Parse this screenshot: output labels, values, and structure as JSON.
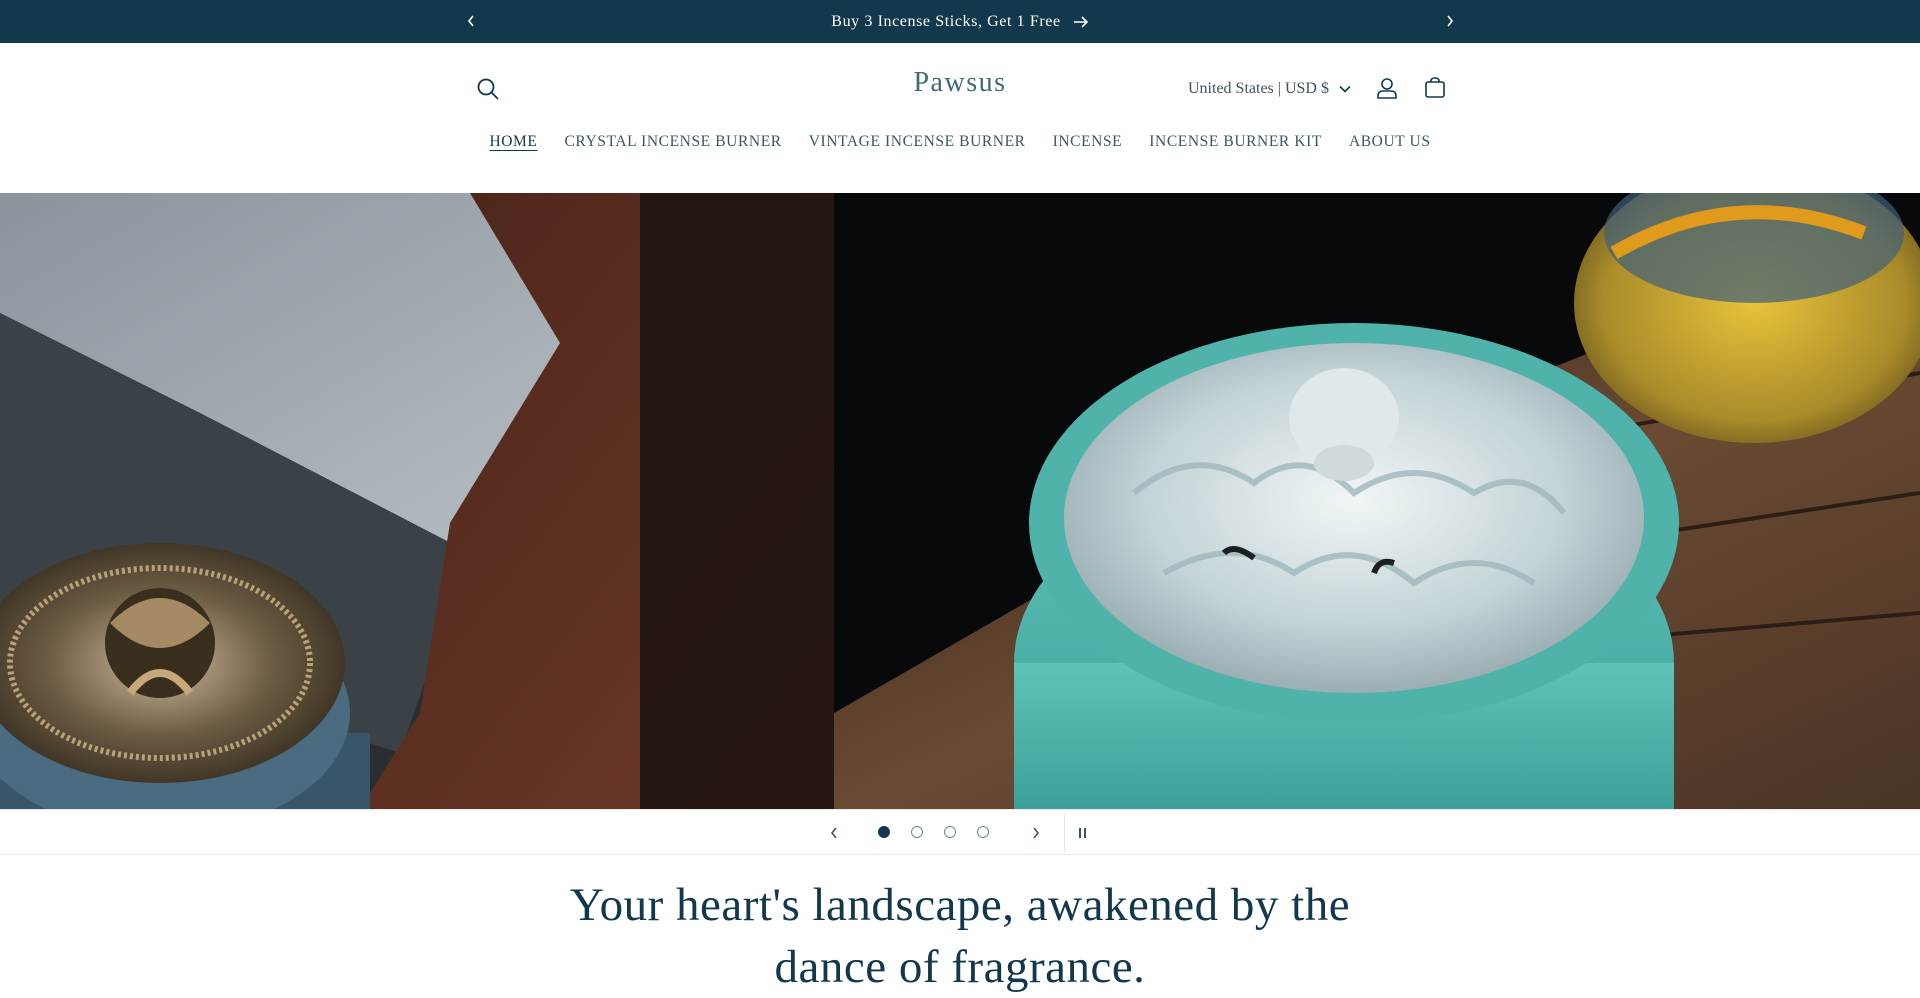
{
  "announcement": {
    "text": "Buy 3 Incense Sticks, Get 1 Free",
    "prev_icon": "chevron-left-icon",
    "next_icon": "chevron-right-icon",
    "link_icon": "arrow-right-icon"
  },
  "header": {
    "logo": "Pawsus",
    "country_selector": "United States | USD $",
    "icons": [
      "search-icon",
      "account-icon",
      "cart-icon"
    ]
  },
  "nav": {
    "items": [
      {
        "label": "HOME",
        "active": true
      },
      {
        "label": "CRYSTAL INCENSE BURNER"
      },
      {
        "label": "VINTAGE INCENSE BURNER"
      },
      {
        "label": "INCENSE"
      },
      {
        "label": "INCENSE BURNER KIT"
      },
      {
        "label": "ABOUT US"
      }
    ]
  },
  "slideshow": {
    "slide_count": 4,
    "active_slide": 1,
    "controls": [
      "chevron-left-icon",
      "chevron-right-icon",
      "pause-icon"
    ]
  },
  "hero_heading": {
    "line1": "Your heart's landscape, awakened by the",
    "line2": "dance of fragrance."
  },
  "colors": {
    "announcement_bg": "#12384b",
    "primary_text": "#12384b",
    "logo": "#3d6a73",
    "teal_product": "#5ec3bb"
  }
}
